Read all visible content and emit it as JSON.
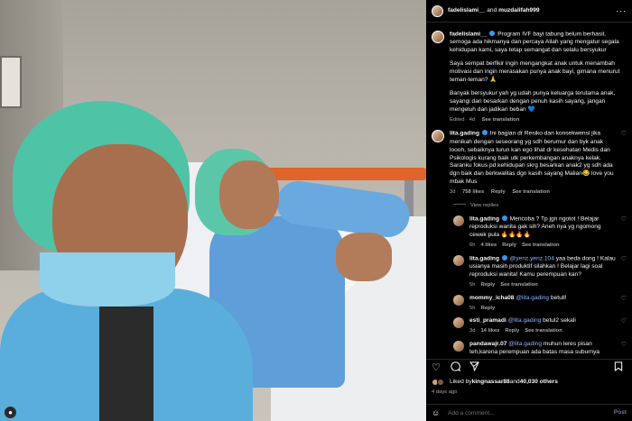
{
  "header": {
    "user1": "fadelislami__",
    "and": " and ",
    "user2": "muzdalifah999",
    "more": "···"
  },
  "caption": {
    "user": "fadelislami__",
    "text1": "Program IVF bayi tabung belum berhasil, semoga ada hikmanya dan percaya Allah yang mengatur segala kehidupan kami, saya tetap semangat dan selalu bersyukur",
    "text2": "Saya sempat berfikir ingin mengangkat anak untuk menambah motivasi dan ingin merasakan punya anak bayi, gimana menurut teman-teman? 🙏",
    "text3": "Banyak bersyukur yah yg udah punya keluarga terutama anak, sayangi dan besarkan dengan penuh kasih sayang, jangan mengeluh dan jadikan beban 💙",
    "meta_edited": "Edited · 4d",
    "meta_translation": "See translation"
  },
  "comments": [
    {
      "user": "lita.gading",
      "text": "Ini bagian dr Resiko dan konsekwensi jika menikah dengan seseorang yg sdh berumur dan byk anak loooh, sebaiknya turun kan ego lihat dr kesehatan Medis dan Psikologis kurang baik utk perkembangan anaknya kelak. Saranku fokus pd kehidupan skrg besarkan anak2 yg sdh ada dgn baik dan berkwalitas dgn kasih sayang Malian😂 love you mbak Mus",
      "time": "3d",
      "likes": "758 likes",
      "reply": "Reply",
      "translation": "See translation",
      "view_replies": "View replies"
    }
  ],
  "replies": [
    {
      "user": "lita.gading",
      "text": "Mencoba ? Tp jgn ngotot ! Belajar reproduksi wanita gak sih? Aneh nya yg ngomong cewek pula 🔥🔥🔥🔥",
      "time": "6h",
      "likes": "4 likes",
      "reply": "Reply",
      "translation": "See translation"
    },
    {
      "user": "lita.gading",
      "mention": "@yenz.yenz.104",
      "text": " yaa beda dong ! Kalau usianya masih produktif silahkan ! Belajar lagi soal reproduksi wanita! Kamu perempuan kan?",
      "time": "5h",
      "reply": "Reply",
      "translation": "See translation"
    },
    {
      "user": "mommy_icha08",
      "mention": "@lita.gading",
      "text": " betull!",
      "time": "5h",
      "reply": "Reply"
    },
    {
      "user": "esti_pramadi",
      "mention": "@lita.gading",
      "text": " betul2 sekali",
      "time": "3d",
      "likes": "14 likes",
      "reply": "Reply",
      "translation": "See translation"
    },
    {
      "user": "pandawajr.07",
      "mention": "@lita.gading",
      "text": " muhun leres pisan teh,karena perempuan ada batas masa suburnya",
      "time": "",
      "reply": ""
    }
  ],
  "likes": {
    "prefix": "Liked by ",
    "user": "kingnassar88",
    "middle": " and ",
    "count": "40,030 others"
  },
  "date": "4 days ago",
  "add_comment": {
    "placeholder": "Add a comment...",
    "post": "Post"
  },
  "icons": [
    "heart-icon",
    "comment-icon",
    "share-icon",
    "bookmark-icon",
    "emoji-icon",
    "more-icon"
  ]
}
